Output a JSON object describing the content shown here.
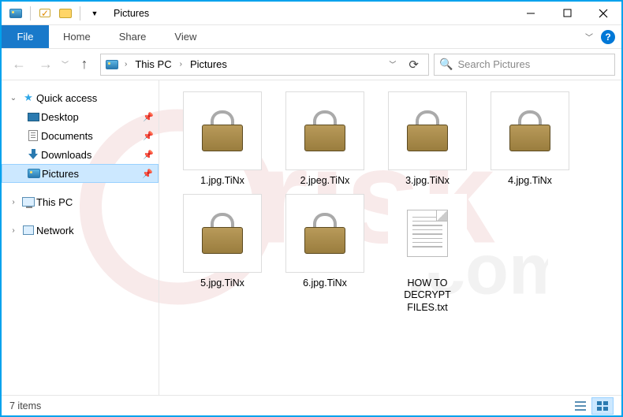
{
  "title": "Pictures",
  "tabs": {
    "file": "File",
    "home": "Home",
    "share": "Share",
    "view": "View"
  },
  "breadcrumb": {
    "seg1": "This PC",
    "seg2": "Pictures"
  },
  "search": {
    "placeholder": "Search Pictures"
  },
  "sidebar": {
    "quick_access": "Quick access",
    "desktop": "Desktop",
    "documents": "Documents",
    "downloads": "Downloads",
    "pictures": "Pictures",
    "this_pc": "This PC",
    "network": "Network"
  },
  "files": [
    {
      "name": "1.jpg.TiNx",
      "type": "lock"
    },
    {
      "name": "2.jpeg.TiNx",
      "type": "lock"
    },
    {
      "name": "3.jpg.TiNx",
      "type": "lock"
    },
    {
      "name": "4.jpg.TiNx",
      "type": "lock"
    },
    {
      "name": "5.jpg.TiNx",
      "type": "lock"
    },
    {
      "name": "6.jpg.TiNx",
      "type": "lock"
    },
    {
      "name": "HOW TO\nDECRYPT\nFILES.txt",
      "type": "txt"
    }
  ],
  "status": {
    "count": "7 items"
  }
}
